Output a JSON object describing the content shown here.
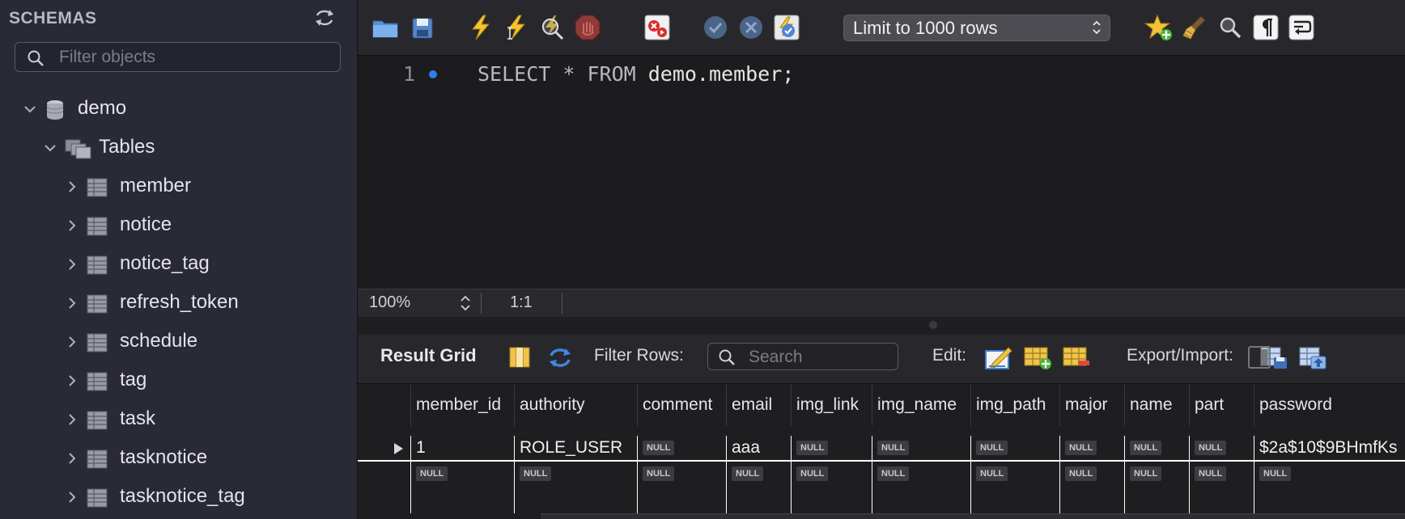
{
  "sidebar": {
    "title": "SCHEMAS",
    "filter_placeholder": "Filter objects",
    "schema": "demo",
    "tables_label": "Tables",
    "tables": [
      "member",
      "notice",
      "notice_tag",
      "refresh_token",
      "schedule",
      "tag",
      "task",
      "tasknotice",
      "tasknotice_tag"
    ]
  },
  "toolbar": {
    "icons": [
      "open-file-icon",
      "save-icon",
      "execute-icon",
      "execute-current-icon",
      "explain-icon",
      "stop-icon",
      "toggle-error-stop-icon",
      "commit-icon",
      "rollback-icon",
      "autocommit-icon",
      "add-snippet-icon",
      "beautify-icon",
      "find-icon",
      "invisible-chars-icon",
      "wrap-icon"
    ],
    "limit_label": "Limit to 1000 rows"
  },
  "editor": {
    "line_number": "1",
    "sql_keyword_1": "SELECT * FROM",
    "sql_rest": " demo.member;"
  },
  "status": {
    "zoom": "100%",
    "cursor_position": "1:1"
  },
  "result": {
    "title": "Result Grid",
    "filter_rows_label": "Filter Rows:",
    "search_placeholder": "Search",
    "edit_label": "Edit:",
    "export_label": "Export/Import:"
  },
  "grid": {
    "columns": [
      "member_id",
      "authority",
      "comment",
      "email",
      "img_link",
      "img_name",
      "img_path",
      "major",
      "name",
      "part",
      "password"
    ],
    "null_text": "NULL",
    "rows": [
      [
        "1",
        "ROLE_USER",
        null,
        "aaa",
        null,
        null,
        null,
        null,
        null,
        null,
        "$2a$10$9BHmfKs"
      ],
      [
        null,
        null,
        null,
        null,
        null,
        null,
        null,
        null,
        null,
        null,
        null
      ]
    ]
  },
  "colors": {
    "sidebar_bg": "#2a2a36",
    "editor_bg": "#1c1c1e",
    "accent_blue": "#2f7fe9"
  }
}
